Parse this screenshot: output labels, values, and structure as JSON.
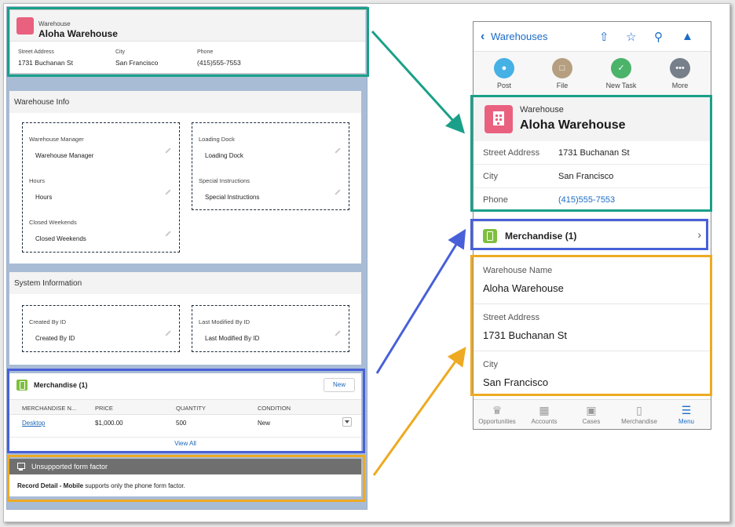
{
  "colors": {
    "green_outline": "#1aa088",
    "blue_outline": "#4860d8",
    "orange_outline": "#eeaa22",
    "link_blue": "#1b6cc7",
    "warehouse_icon": "#e9617f",
    "merchandise_icon": "#7fbf3f"
  },
  "desktop": {
    "header": {
      "object_label": "Warehouse",
      "record_title": "Aloha Warehouse",
      "fields": [
        {
          "label": "Street Address",
          "value": "1731 Buchanan St"
        },
        {
          "label": "City",
          "value": "San Francisco"
        },
        {
          "label": "Phone",
          "value": "(415)555-7553"
        }
      ]
    },
    "warehouse_info": {
      "title": "Warehouse Info",
      "left_fields": [
        {
          "label": "Warehouse Manager",
          "value": "Warehouse Manager"
        },
        {
          "label": "Hours",
          "value": "Hours"
        },
        {
          "label": "Closed Weekends",
          "value": "Closed Weekends"
        }
      ],
      "right_fields": [
        {
          "label": "Loading Dock",
          "value": "Loading Dock"
        },
        {
          "label": "Special Instructions",
          "value": "Special Instructions"
        }
      ]
    },
    "system_info": {
      "title": "System Information",
      "left_field": {
        "label": "Created By ID",
        "value": "Created By ID"
      },
      "right_field": {
        "label": "Last Modified By ID",
        "value": "Last Modified By ID"
      }
    },
    "merchandise": {
      "title": "Merchandise (1)",
      "new_label": "New",
      "columns": [
        "MERCHANDISE N...",
        "PRICE",
        "QUANTITY",
        "CONDITION"
      ],
      "row": {
        "name": "Desktop",
        "price": "$1,000.00",
        "quantity": "500",
        "condition": "New"
      },
      "view_all": "View All"
    },
    "unsupported": {
      "title": "Unsupported form factor",
      "message_bold": "Record Detail - Mobile",
      "message_rest": " supports only the phone form factor."
    }
  },
  "phone": {
    "nav": {
      "back_label": "Warehouses",
      "icons": [
        "share-icon",
        "star-icon",
        "search-icon",
        "bell-icon"
      ]
    },
    "actions": [
      {
        "label": "Post",
        "icon": "chat-icon",
        "color": "#45b1e4"
      },
      {
        "label": "File",
        "icon": "file-icon",
        "color": "#b59f80"
      },
      {
        "label": "New Task",
        "icon": "task-icon",
        "color": "#4bb36a"
      },
      {
        "label": "More",
        "icon": "more-icon",
        "color": "#777f8a"
      }
    ],
    "header": {
      "object_label": "Warehouse",
      "record_title": "Aloha Warehouse",
      "fields": [
        {
          "label": "Street Address",
          "value": "1731 Buchanan St"
        },
        {
          "label": "City",
          "value": "San Francisco"
        },
        {
          "label": "Phone",
          "value": "(415)555-7553"
        }
      ]
    },
    "related": {
      "title": "Merchandise (1)"
    },
    "card": [
      {
        "label": "Warehouse Name",
        "value": "Aloha Warehouse"
      },
      {
        "label": "Street Address",
        "value": "1731 Buchanan St"
      },
      {
        "label": "City",
        "value": "San Francisco"
      }
    ],
    "tabs": [
      {
        "label": "Opportunities",
        "icon": "crown-icon"
      },
      {
        "label": "Accounts",
        "icon": "building-icon"
      },
      {
        "label": "Cases",
        "icon": "briefcase-icon"
      },
      {
        "label": "Merchandise",
        "icon": "phone-icon"
      },
      {
        "label": "Menu",
        "icon": "menu-icon"
      }
    ]
  }
}
